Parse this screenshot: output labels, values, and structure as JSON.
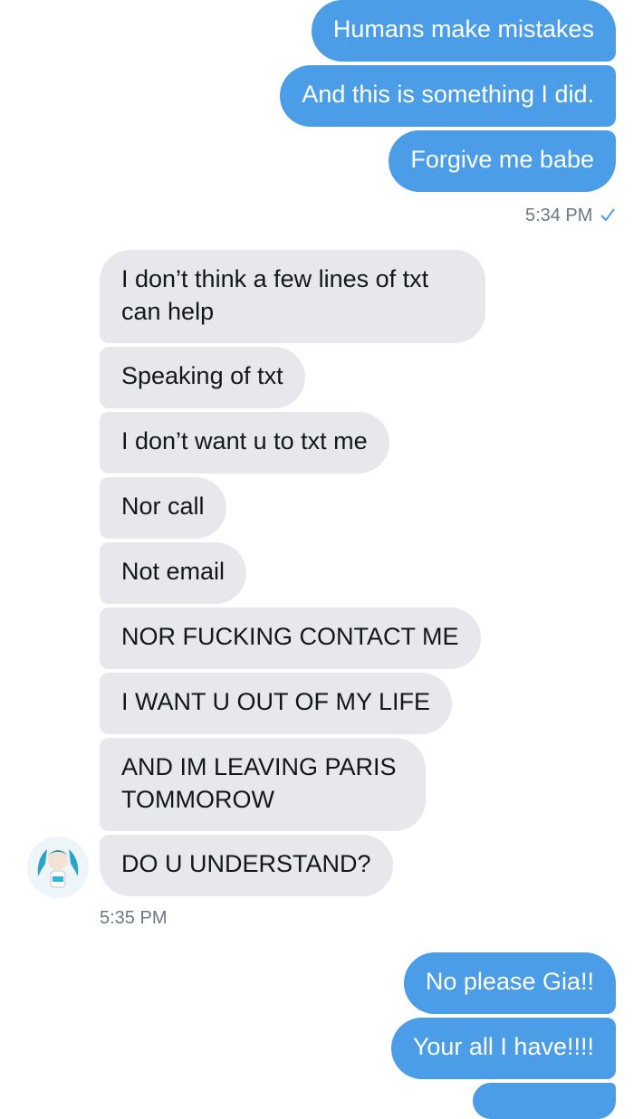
{
  "messages_sent_1": [
    "Humans make mistakes",
    "And this is something I did.",
    "Forgive me babe"
  ],
  "timestamp_sent_1": "5:34 PM",
  "read_receipt_icon": "checkmark-icon",
  "messages_received": [
    "I don’t think a few lines of txt can help",
    "Speaking of txt",
    "I don’t want u to txt me",
    "Nor call",
    "Not email",
    "NOR FUCKING CONTACT ME",
    "I WANT U OUT OF MY LIFE",
    "AND IM LEAVING PARIS TOMMOROW",
    "DO U UNDERSTAND?"
  ],
  "timestamp_received": "5:35 PM",
  "avatar_icon": "profile-avatar-icon",
  "messages_sent_2": [
    "No please Gia!!",
    "Your all I have!!!!"
  ],
  "colors": {
    "sent_bubble": "#4a9de6",
    "received_bubble": "#e6e8ec",
    "timestamp": "#6b7884"
  }
}
